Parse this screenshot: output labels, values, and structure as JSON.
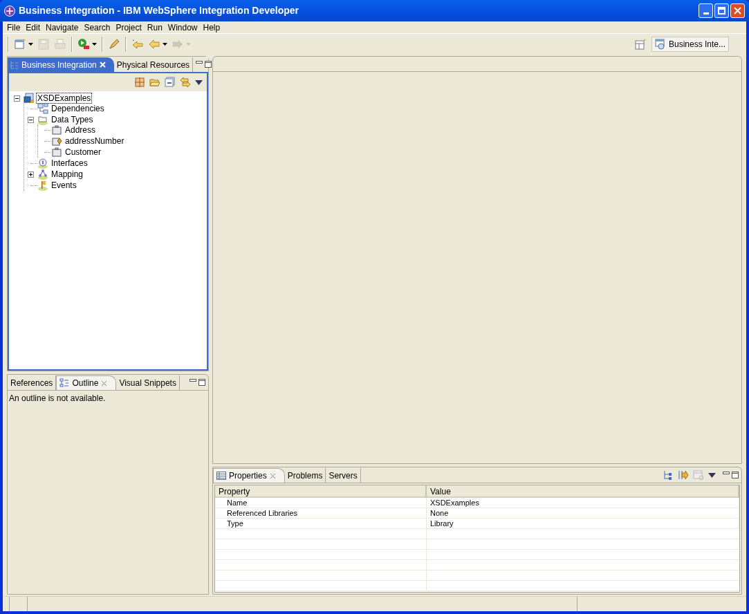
{
  "window": {
    "title": "Business Integration - IBM WebSphere Integration Developer"
  },
  "menu": [
    "File",
    "Edit",
    "Navigate",
    "Search",
    "Project",
    "Run",
    "Window",
    "Help"
  ],
  "toolbar": [
    {
      "kind": "new",
      "disabled": false
    },
    {
      "kind": "save",
      "disabled": true
    },
    {
      "kind": "print",
      "disabled": true
    },
    {
      "kind": "run",
      "disabled": false
    },
    {
      "kind": "pen",
      "disabled": false
    },
    {
      "kind": "last-edit",
      "disabled": false
    },
    {
      "kind": "back",
      "disabled": false
    },
    {
      "kind": "forward",
      "disabled": true
    }
  ],
  "perspective": {
    "label": "Business Inte..."
  },
  "navigator": {
    "tabs": [
      {
        "label": "Business Integration",
        "selected": true
      },
      {
        "label": "Physical Resources",
        "selected": false
      }
    ],
    "tree": [
      {
        "label": "XSDExamples",
        "selected": true,
        "expanded": true,
        "children": [
          {
            "label": "Dependencies",
            "selected": false
          },
          {
            "label": "Data Types",
            "selected": false,
            "expanded": true,
            "children": [
              {
                "label": "Address",
                "selected": false
              },
              {
                "label": "addressNumber",
                "selected": false
              },
              {
                "label": "Customer",
                "selected": false
              }
            ]
          },
          {
            "label": "Interfaces",
            "selected": false
          },
          {
            "label": "Mapping",
            "selected": false,
            "expanded": false
          },
          {
            "label": "Events",
            "selected": false
          }
        ]
      }
    ]
  },
  "outline": {
    "tabs": [
      {
        "label": "References",
        "selected": false
      },
      {
        "label": "Outline",
        "selected": true
      },
      {
        "label": "Visual Snippets",
        "selected": false
      }
    ],
    "message": "An outline is not available."
  },
  "properties": {
    "tabs": [
      {
        "label": "Properties",
        "selected": true
      },
      {
        "label": "Problems",
        "selected": false
      },
      {
        "label": "Servers",
        "selected": false
      }
    ],
    "columns": [
      "Property",
      "Value"
    ],
    "rows": [
      [
        "Name",
        "XSDExamples"
      ],
      [
        "Referenced Libraries",
        "None"
      ],
      [
        "Type",
        "Library"
      ]
    ]
  }
}
